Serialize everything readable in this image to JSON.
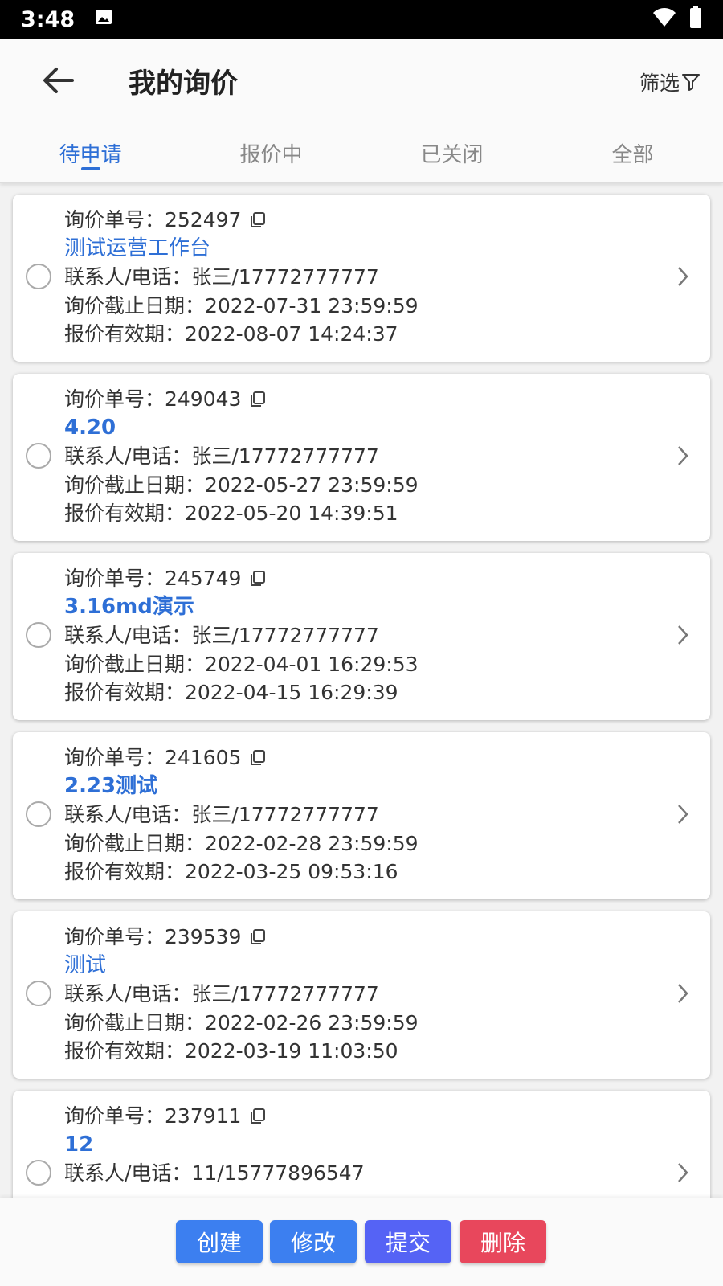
{
  "status_bar": {
    "time": "3:48",
    "icons": [
      "image-icon",
      "wifi-icon",
      "battery-icon"
    ]
  },
  "header": {
    "title": "我的询价",
    "filter_label": "筛选",
    "back_icon": "back-arrow-icon",
    "filter_icon": "funnel-icon"
  },
  "tabs": [
    {
      "label": "待申请",
      "active": true
    },
    {
      "label": "报价中",
      "active": false
    },
    {
      "label": "已关闭",
      "active": false
    },
    {
      "label": "全部",
      "active": false
    }
  ],
  "colors": {
    "accent": "#2e6fd6",
    "create_button": "#3c7ff0",
    "edit_button": "#3c7ff0",
    "submit_button": "#5563f5",
    "delete_button": "#e8475c"
  },
  "cards": [
    {
      "order_no": "询价单号：252497",
      "title": "测试运营工作台",
      "title_bold": false,
      "contact": "联系人/电话：张三/17772777777",
      "deadline": "询价截止日期：2022-07-31 23:59:59",
      "validity": "报价有效期：2022-08-07 14:24:37"
    },
    {
      "order_no": "询价单号：249043",
      "title": "4.20",
      "title_bold": true,
      "contact": "联系人/电话：张三/17772777777",
      "deadline": "询价截止日期：2022-05-27 23:59:59",
      "validity": "报价有效期：2022-05-20 14:39:51"
    },
    {
      "order_no": "询价单号：245749",
      "title": "3.16md演示",
      "title_bold": true,
      "contact": "联系人/电话：张三/17772777777",
      "deadline": "询价截止日期：2022-04-01 16:29:53",
      "validity": "报价有效期：2022-04-15 16:29:39"
    },
    {
      "order_no": "询价单号：241605",
      "title": "2.23测试",
      "title_bold": true,
      "contact": "联系人/电话：张三/17772777777",
      "deadline": "询价截止日期：2022-02-28 23:59:59",
      "validity": "报价有效期：2022-03-25 09:53:16"
    },
    {
      "order_no": "询价单号：239539",
      "title": "测试",
      "title_bold": false,
      "contact": "联系人/电话：张三/17772777777",
      "deadline": "询价截止日期：2022-02-26 23:59:59",
      "validity": "报价有效期：2022-03-19 11:03:50"
    },
    {
      "order_no": "询价单号：237911",
      "title": "12",
      "title_bold": true,
      "contact": "联系人/电话：11/15777896547",
      "deadline": "",
      "validity": ""
    }
  ],
  "actions": {
    "create": "创建",
    "edit": "修改",
    "submit": "提交",
    "delete": "删除"
  }
}
